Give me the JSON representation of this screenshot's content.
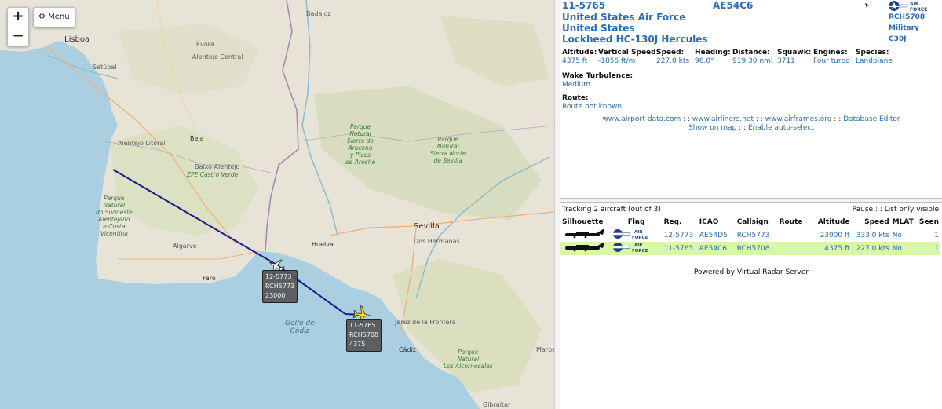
{
  "map": {
    "controls": {
      "zoom_in": "+",
      "zoom_out": "−",
      "menu_label": "Menu"
    },
    "labels": {
      "lisboa": "Lisboa",
      "setubal": "Setúbal",
      "badajoz": "Badajoz",
      "evora": "Évora",
      "alentejo_central": "Alentejo Central",
      "alentejo_litoral": "Alentejo Litoral",
      "beja": "Beja",
      "baixo_alentejo": "Baixo Alentejo",
      "zpe_castro_verde": "ZPE Castro Verde",
      "algarve": "Algarve",
      "faro": "Faro",
      "huelva": "Huelva",
      "sevilla": "Sevilla",
      "dos_hermanas": "Dos Hermanas",
      "jerez": "Jerez de la Frontera",
      "cadiz": "Cádiz",
      "gibraltar": "Gibraltar",
      "marbella": "Marbe",
      "park_sudoeste": "Parque\nNatural\ndo Sudoeste\nAlentejano\ne Costa\nVicentina",
      "park_aracena": "Parque\nNatural\nSierra de\nAracena\ny Picos\nde Aroche",
      "park_norte_sevilla": "Parque\nNatural\nSierra Norte\nde Sevilla",
      "park_alcornocales": "Parque\nNatural\nLos Alcornocales",
      "golfo_cadiz": "Golfo de\nCádiz"
    },
    "aircraft": [
      {
        "reg": "12-5773",
        "callsign": "RCH5773",
        "altitude": "23000",
        "icon_color": "#ffffff"
      },
      {
        "reg": "11-5765",
        "callsign": "RCH5708",
        "altitude": "4375",
        "icon_color": "#f3e600"
      }
    ],
    "track_color": "#1a1a8c"
  },
  "detail": {
    "registration": "11-5765",
    "icao": "AE54C6",
    "operator": "United States Air Force",
    "country": "United States",
    "model": "Lockheed HC-130J Hercules",
    "callsign": "RCH5708",
    "category": "Military",
    "type_code": "C30J",
    "fields": [
      {
        "label": "Altitude:",
        "value": "4375 ft"
      },
      {
        "label": "Vertical Speed:",
        "value": "-1856 ft/m"
      },
      {
        "label": "Speed:",
        "value": "227.0 kts"
      },
      {
        "label": "Heading:",
        "value": "96.0°"
      },
      {
        "label": "Distance:",
        "value": "919.30 nmi"
      },
      {
        "label": "Squawk:",
        "value": "3711"
      },
      {
        "label": "Engines:",
        "value": "Four turbo"
      },
      {
        "label": "Species:",
        "value": "Landplane"
      }
    ],
    "wake_label": "Wake Turbulence:",
    "wake_value": "Medium",
    "route_label": "Route:",
    "route_value": "Route not known",
    "links": {
      "airport_data": "www.airport-data.com",
      "airliners": "www.airliners.net",
      "airframes": "www.airframes.org",
      "db_editor": "Database Editor",
      "show_on_map": "Show on map",
      "auto_select": "Enable auto-select",
      "sep": " : : "
    }
  },
  "list": {
    "tracking_text": "Tracking 2 aircraft (out of 3)",
    "pause": "Pause",
    "sep": " : : ",
    "list_only_visible": "List only visible",
    "columns": [
      "Silhouette",
      "Flag",
      "Reg.",
      "ICAO",
      "Callsign",
      "Route",
      "Altitude",
      "Speed",
      "MLAT",
      "Seen"
    ],
    "rows": [
      {
        "reg": "12-5773",
        "icao": "AE54D5",
        "callsign": "RCH5773",
        "route": "",
        "altitude": "23000 ft",
        "speed": "333.0 kts",
        "mlat": "No",
        "seen": "1"
      },
      {
        "reg": "11-5765",
        "icao": "AE54C6",
        "callsign": "RCH5708",
        "route": "",
        "altitude": "4375 ft",
        "speed": "227.0 kts",
        "mlat": "No",
        "seen": "1"
      }
    ],
    "flag_text": "AIR FORCE",
    "powered_by": "Powered by Virtual Radar Server"
  }
}
